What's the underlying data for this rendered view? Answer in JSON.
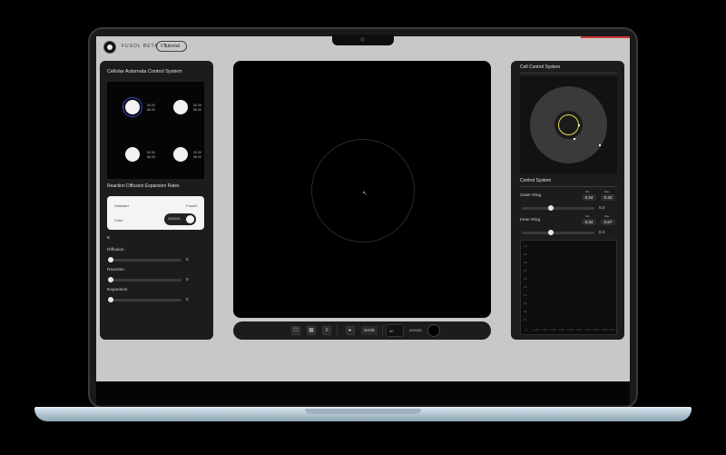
{
  "app": {
    "brand": "FUSOL BETA V1",
    "tutorial_label": "Tutorial"
  },
  "left_panel": {
    "automata_title": "Cellular Automata Control System",
    "cells": [
      {
        "a": "00.00",
        "b": "86.00"
      },
      {
        "a": "00.00",
        "b": "96.00"
      },
      {
        "a": "00.00",
        "b": "86.00"
      },
      {
        "a": "00.00",
        "b": "96.00"
      }
    ],
    "rates_title": "Reaction Diffusion Expansion Rates",
    "card": {
      "selected_label": "Selected",
      "selected_value": "FusoN",
      "color_label": "Color",
      "toggle_label": "#000000"
    },
    "section_label": "E",
    "sliders": [
      {
        "label": "Diffusion",
        "value": "0",
        "level": 0.0
      },
      {
        "label": "Reaction",
        "value": "0",
        "level": 0.0
      },
      {
        "label": "Expansion",
        "value": "0",
        "level": 0.0
      }
    ]
  },
  "toolbar": {
    "save_label": "SAVE",
    "input_value": "50",
    "color_label": "#000000"
  },
  "right_panel": {
    "cell_title": "Cell Control System",
    "control_title": "Control System",
    "outer": {
      "label": "Outer Ring",
      "min_label": "Min",
      "max_label": "Max",
      "min": "0.24",
      "max": "0.32",
      "value": "0.4",
      "level": 0.4
    },
    "inner": {
      "label": "Inner Ring",
      "min_label": "Min",
      "max_label": "Max",
      "min": "0.34",
      "max": "0.67",
      "value": "0.4",
      "level": 0.4
    },
    "graph_y_ticks": [
      "1.0",
      "0.9",
      "0.8",
      "0.7",
      "0.6",
      "0.5",
      "0.4",
      "0.3",
      "0.2",
      "0.1"
    ],
    "graph_x_ticks": [
      "0.0",
      "0.1000",
      "0.2000",
      "0.3000",
      "0.4000",
      "0.5000",
      "0.6000",
      "0.7000",
      "0.8000",
      "0.9000",
      "1.000"
    ]
  },
  "colors": {
    "panel": "#1c1c1c",
    "canvas": "#000000",
    "screen_bg": "#c8c8c8",
    "accent_ring": "#e0d54a"
  }
}
